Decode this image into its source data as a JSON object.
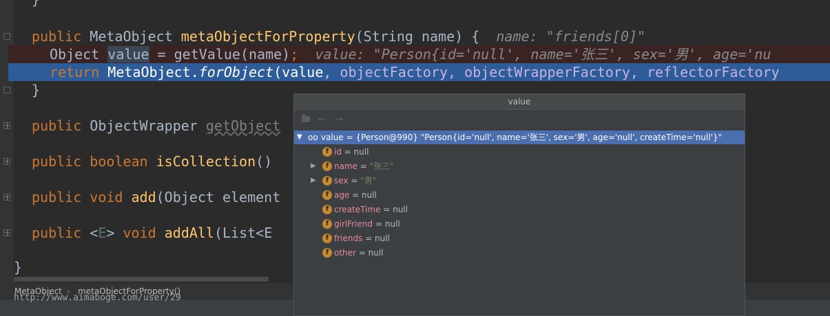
{
  "code": {
    "l0_brace": "}",
    "l1_kw": "public",
    "l1_type": " MetaObject ",
    "l1_fn": "metaObjectForProperty",
    "l1_params": "(String name) {",
    "l1_hint": "name: \"friends[0]\"",
    "l2_type": "Object ",
    "l2_var": "value",
    "l2_rest": " = getValue(name)",
    "l2_semi": ";",
    "l2_hint": "value: \"Person{id='null', name='张三', sex='男', age='nu",
    "l3_kw": "return",
    "l3_cls": " MetaObject.",
    "l3_fn": "forObject",
    "l3_paren": "(value",
    "l3_args": ", objectFactory, objectWrapperFactory, reflectorFactory",
    "l4_brace": "}",
    "l5_kw": "public",
    "l5_type": " ObjectWrapper ",
    "l5_fn": "getObject",
    "l6_kw": "public boolean",
    "l6_fn": " isCollection",
    "l6_rest": "()",
    "l7_kw": "public void",
    "l7_fn": " add",
    "l7_rest": "(Object element",
    "l8_kw": "public",
    "l8_lt": " <",
    "l8_gen": "E",
    "l8_gt": "> ",
    "l8_kw2": "void",
    "l8_fn": " addAll",
    "l8_rest": "(List<E",
    "l9_brace": "}"
  },
  "breadcrumb": {
    "class_name": "MetaObject",
    "method_name": "metaObjectForProperty()"
  },
  "watermark": "http://www.aimaboge.com/user/29",
  "popup": {
    "title": "value",
    "toolbar": {
      "pin_icon": "pin-icon",
      "back": "←",
      "forward": "→"
    },
    "root": {
      "text": "value = {Person@990} \"Person{id='null', name='张三', sex='男', age='null', createTime='null'}\""
    },
    "fields": [
      {
        "name": "id",
        "eq": " = ",
        "value": "null",
        "expandable": false,
        "is_string": false
      },
      {
        "name": "name",
        "eq": " = ",
        "value": "\"张三\"",
        "expandable": true,
        "is_string": true
      },
      {
        "name": "sex",
        "eq": " = ",
        "value": "\"男\"",
        "expandable": true,
        "is_string": true
      },
      {
        "name": "age",
        "eq": " = ",
        "value": "null",
        "expandable": false,
        "is_string": false
      },
      {
        "name": "createTime",
        "eq": " = ",
        "value": "null",
        "expandable": false,
        "is_string": false
      },
      {
        "name": "girlFriend",
        "eq": " = ",
        "value": "null",
        "expandable": false,
        "is_string": false
      },
      {
        "name": "friends",
        "eq": " = ",
        "value": "null",
        "expandable": false,
        "is_string": false
      },
      {
        "name": "other",
        "eq": " = ",
        "value": "null",
        "expandable": false,
        "is_string": false
      }
    ],
    "field_icon_letter": "f"
  },
  "colors": {
    "keyword": "#cc7832",
    "method": "#ffc66d",
    "selection": "#4b6eaf",
    "execution_line": "#2d5c99",
    "field_name": "#e8899b",
    "string": "#6a8759"
  }
}
